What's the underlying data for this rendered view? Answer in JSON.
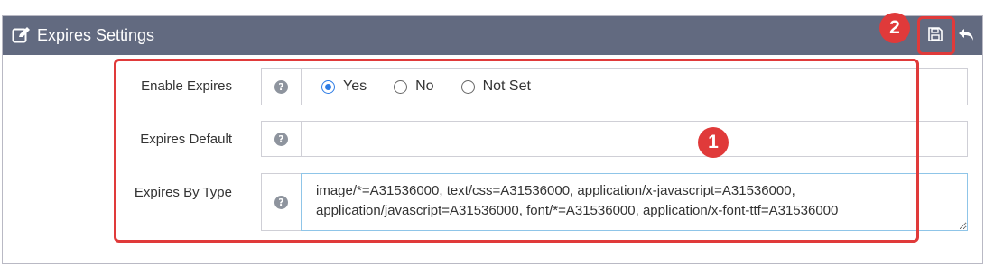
{
  "panel": {
    "title": "Expires Settings",
    "edit_icon": "edit-icon",
    "save_icon": "floppy-disk-icon",
    "undo_icon": "undo-arrow-icon"
  },
  "fields": {
    "enable_expires": {
      "label": "Enable Expires",
      "options": [
        "Yes",
        "No",
        "Not Set"
      ],
      "selected": "Yes"
    },
    "expires_default": {
      "label": "Expires Default",
      "value": ""
    },
    "expires_by_type": {
      "label": "Expires By Type",
      "value": "image/*=A31536000, text/css=A31536000, application/x-javascript=A31536000, application/javascript=A31536000, font/*=A31536000, application/x-font-ttf=A31536000"
    }
  },
  "help_icon_glyph": "?",
  "callouts": {
    "one": "1",
    "two": "2"
  },
  "colors": {
    "header_bg": "#626a80",
    "callout": "#e03a3a",
    "radio_selected": "#2c7be5"
  }
}
